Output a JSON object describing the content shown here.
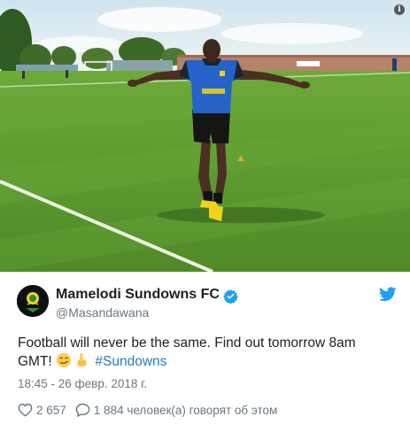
{
  "photo": {
    "alt_subject": "player-on-pitch",
    "info_glyph": "i",
    "sky_color": "#dfeef5",
    "grass_color": "#5d9a2f",
    "jersey_color": "#2563c9",
    "jersey_trim_color": "#f2d21b"
  },
  "author": {
    "name": "Mamelodi Sundowns FC",
    "handle": "@Masandawana",
    "verified": true
  },
  "tweet": {
    "line1": "Football will never be the same. Find out tomorrow 8am",
    "line2_prefix": "GMT!",
    "emojis": [
      "smirking-face",
      "pointing-up-hand"
    ],
    "hashtag": "#Sundowns",
    "timestamp": "18:45 - 26 февр. 2018 г."
  },
  "actions": {
    "likes": "2 657",
    "replies": "1 884 человек(а) говорят об этом"
  },
  "colors": {
    "text": "#1c2022",
    "secondary": "#697882",
    "link": "#2b7bb9",
    "verified": "#1da1f2",
    "twitter_blue": "#1da1f2"
  }
}
